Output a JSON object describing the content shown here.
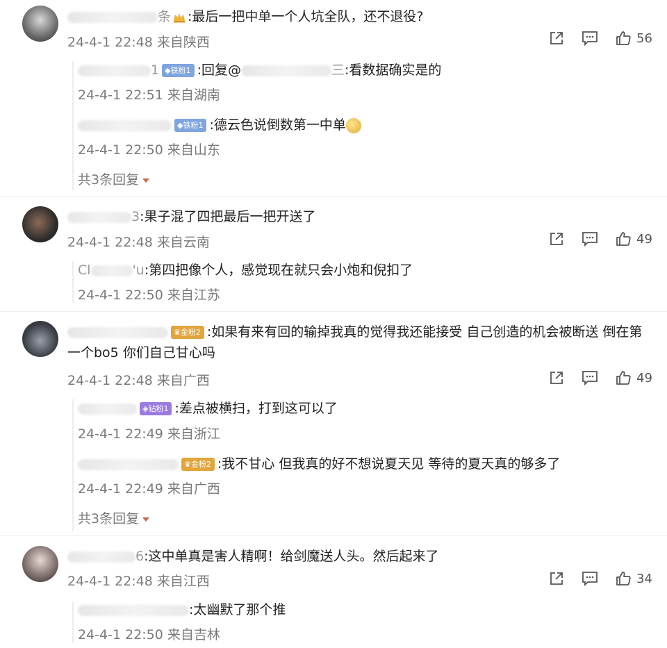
{
  "icons": {
    "share": "share-icon",
    "comment": "comment-icon",
    "like": "like-icon"
  },
  "colors": {
    "meta": "#7a7a7a",
    "more_caret": "#c06a4a",
    "badge_blue": "#7fa5de",
    "badge_purple": "#9b7ae0",
    "badge_gold": "#e1a53c"
  },
  "threads": [
    {
      "user_tail": "条",
      "text": ":最后一把中单一个人坑全队，还不退役?",
      "meta": "24-4-1 22:48 来自陕西",
      "likes": "56",
      "replies": [
        {
          "user_tail": "1",
          "badge": "铁粉1",
          "text_prefix": ":回复@",
          "mention_tail": "三",
          "text": ":看数据确实是的",
          "meta": "24-4-1 22:51 来自湖南"
        },
        {
          "user_tail": "",
          "badge": "铁粉1",
          "text": ":德云色说倒数第一中单",
          "meta": "24-4-1 22:50 来自山东"
        }
      ],
      "more": "共3条回复"
    },
    {
      "user_tail": "3",
      "text": ":果子混了四把最后一把开送了",
      "meta": "24-4-1 22:48 来自云南",
      "likes": "49",
      "replies": [
        {
          "user_head": "Cl",
          "user_tail": "'u",
          "text": ":第四把像个人，感觉现在就只会小炮和倪扣了",
          "meta": "24-4-1 22:50 来自江苏"
        }
      ]
    },
    {
      "user_tail": "",
      "badge": "金粉2",
      "text": ":如果有来有回的输掉我真的觉得我还能接受 自己创造的机会被断送 倒在第一个bo5 你们自己甘心吗",
      "meta": "24-4-1 22:48 来自广西",
      "likes": "49",
      "replies": [
        {
          "badge": "钻粉1",
          "text": ":差点被横扫，打到这可以了",
          "meta": "24-4-1 22:49 来自浙江"
        },
        {
          "badge": "金粉2",
          "text": ":我不甘心 但我真的好不想说夏天见 等待的夏天真的够多了",
          "meta": "24-4-1 22:49 来自广西"
        }
      ],
      "more": "共3条回复"
    },
    {
      "user_tail": "6",
      "text": ":这中单真是害人精啊！给剑魔送人头。然后起来了",
      "meta": "24-4-1 22:48 来自江西",
      "likes": "34",
      "replies": [
        {
          "text": ":太幽默了那个推",
          "meta": "24-4-1 22:50 来自吉林"
        }
      ]
    }
  ]
}
